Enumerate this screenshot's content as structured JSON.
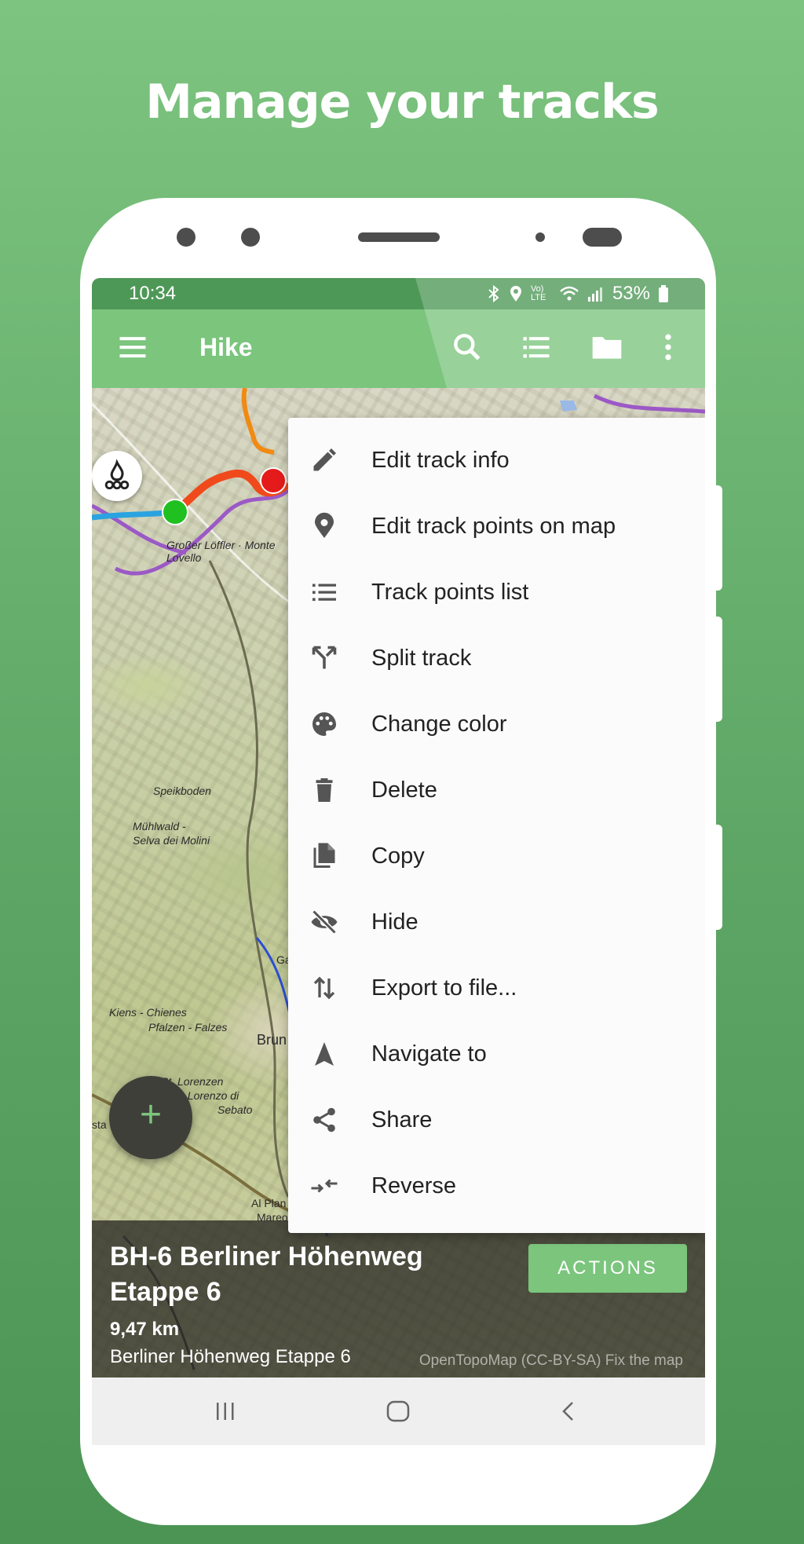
{
  "headline": "Manage your tracks",
  "status": {
    "time": "10:34",
    "network": "Vo) LTE",
    "battery": "53%"
  },
  "appbar": {
    "title": "Hike",
    "icons": [
      "menu-icon",
      "search-icon",
      "list-icon",
      "folder-icon",
      "more-vert-icon"
    ]
  },
  "map_labels": {
    "loffler": "Großer Löffler · Monte Lovello",
    "speikboden": "Speikboden",
    "muhlwald_1": "Mühlwald -",
    "muhlwald_2": "Selva dei Molini",
    "kiens_1": "Kiens - Chienes",
    "kiens_2": "Pfalzen - Falzes",
    "lorenzen_1": "St. Lorenzen",
    "lorenzen_2": "San Lorenzo di",
    "lorenzen_3": "Sebato",
    "bruneck": "Brun",
    "alplan": "Al Plan",
    "mareo": "Mareo",
    "sta": "sta",
    "ga": "Ga"
  },
  "menu": {
    "items": [
      {
        "label": "Edit track info",
        "icon": "pencil-icon"
      },
      {
        "label": "Edit track points on map",
        "icon": "map-pin-icon"
      },
      {
        "label": "Track points list",
        "icon": "list-icon"
      },
      {
        "label": "Split track",
        "icon": "split-icon"
      },
      {
        "label": "Change color",
        "icon": "palette-icon"
      },
      {
        "label": "Delete",
        "icon": "trash-icon"
      },
      {
        "label": "Copy",
        "icon": "copy-icon"
      },
      {
        "label": "Hide",
        "icon": "eye-off-icon"
      },
      {
        "label": "Export to file...",
        "icon": "swap-vertical-icon"
      },
      {
        "label": "Navigate to",
        "icon": "navigation-icon"
      },
      {
        "label": "Share",
        "icon": "share-icon"
      },
      {
        "label": "Reverse",
        "icon": "reverse-icon"
      }
    ]
  },
  "fab": {
    "label": "+"
  },
  "track": {
    "name": "BH-6 Berliner Höhenweg Etappe 6",
    "distance": "9,47 km",
    "description": "Berliner Höhenweg Etappe 6",
    "attribution": "OpenTopoMap (CC-BY-SA)  Fix the map",
    "actions_label": "ACTIONS"
  },
  "colors": {
    "accent": "#7bc57d",
    "status": "#4e9857",
    "background": "#6bb870"
  }
}
